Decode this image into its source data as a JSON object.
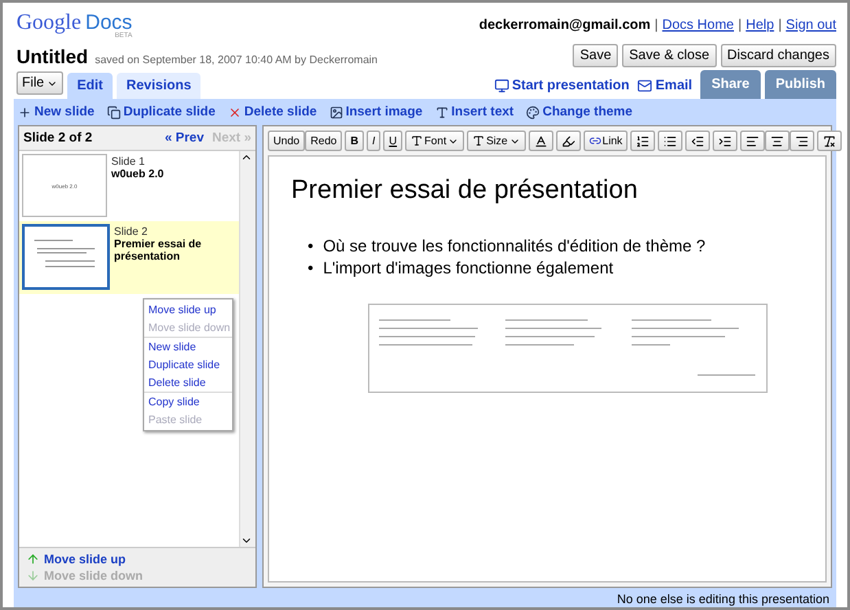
{
  "header": {
    "logo": {
      "brand": "Google",
      "product": "Docs",
      "badge": "BETA"
    },
    "user_email": "deckerromain@gmail.com",
    "links": [
      "Docs Home",
      "Help",
      "Sign out"
    ],
    "link_separator": "|"
  },
  "document": {
    "title": "Untitled",
    "saved_info": "saved on September 18, 2007 10:40 AM by Deckerromain"
  },
  "doc_buttons": [
    "Save",
    "Save & close",
    "Discard changes"
  ],
  "file_menu": "File",
  "tabs": [
    {
      "label": "Edit",
      "selected": true
    },
    {
      "label": "Revisions",
      "selected": false
    }
  ],
  "share_links": [
    {
      "label": "Start presentation",
      "kind": "presentation"
    },
    {
      "label": "Email",
      "kind": "email"
    }
  ],
  "share_buttons": [
    "Share",
    "Publish"
  ],
  "slide_actions": [
    {
      "label": "New slide",
      "kind": "new"
    },
    {
      "label": "Duplicate slide",
      "kind": "duplicate"
    },
    {
      "label": "Delete slide",
      "kind": "delete"
    },
    {
      "label": "Insert image",
      "kind": "image"
    },
    {
      "label": "Insert text",
      "kind": "text"
    },
    {
      "label": "Change theme",
      "kind": "theme"
    }
  ],
  "slide_panel": {
    "counter": "Slide 2 of 2",
    "prev": {
      "label": "« Prev",
      "disabled": false
    },
    "next": {
      "label": "Next »",
      "disabled": true
    },
    "slides": [
      {
        "number": "Slide 1",
        "title": "w0ueb 2.0",
        "thumb_text": "w0ueb 2.0",
        "selected": false
      },
      {
        "number": "Slide 2",
        "title": "Premier essai de présentation",
        "selected": true
      }
    ],
    "context_menu": [
      [
        {
          "label": "Move slide up",
          "disabled": false
        },
        {
          "label": "Move slide down",
          "disabled": true
        }
      ],
      [
        {
          "label": "New slide",
          "disabled": false
        },
        {
          "label": "Duplicate slide",
          "disabled": false
        },
        {
          "label": "Delete slide",
          "disabled": false
        }
      ],
      [
        {
          "label": "Copy slide",
          "disabled": false
        },
        {
          "label": "Paste slide",
          "disabled": true
        }
      ]
    ],
    "footer": [
      {
        "label": "Move slide up",
        "disabled": false
      },
      {
        "label": "Move slide down",
        "disabled": true
      }
    ]
  },
  "format_toolbar": [
    [
      {
        "kind": "plain",
        "label": "Undo"
      },
      {
        "kind": "plain",
        "label": "Redo"
      }
    ],
    [
      {
        "kind": "bold",
        "label": "B"
      }
    ],
    [
      {
        "kind": "italic",
        "label": "I"
      }
    ],
    [
      {
        "kind": "underline",
        "label": "U"
      }
    ],
    [
      {
        "kind": "font",
        "label": "Font"
      }
    ],
    [
      {
        "kind": "size",
        "label": "Size"
      }
    ],
    [
      {
        "kind": "text-color"
      }
    ],
    [
      {
        "kind": "highlight"
      }
    ],
    [
      {
        "kind": "link",
        "label": "Link"
      }
    ],
    [
      {
        "kind": "numbered-list"
      }
    ],
    [
      {
        "kind": "bulleted-list"
      }
    ],
    [
      {
        "kind": "outdent"
      }
    ],
    [
      {
        "kind": "indent"
      }
    ],
    [
      {
        "kind": "align-left"
      },
      {
        "kind": "align-center"
      },
      {
        "kind": "align-right"
      }
    ],
    [
      {
        "kind": "clear-format"
      }
    ]
  ],
  "slide": {
    "title": "Premier essai de présentation",
    "bullet_marker": "•",
    "bullets": [
      "Où se trouve les fonctionnalités d'édition de thème ?",
      "L'import d'images fonctionne également"
    ]
  },
  "status": "No one else is editing this presentation"
}
